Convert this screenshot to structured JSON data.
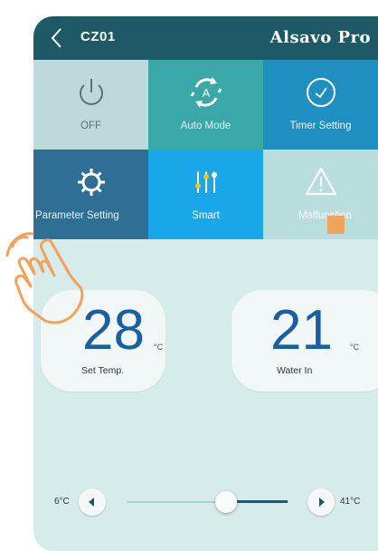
{
  "header": {
    "device_name": "CZ01",
    "app_title": "Alsavo Pro"
  },
  "tiles": [
    {
      "label": "OFF",
      "icon": "power-icon"
    },
    {
      "label": "Auto Mode",
      "icon": "auto-mode-icon"
    },
    {
      "label": "Timer Setting",
      "icon": "clock-icon"
    },
    {
      "label": "Parameter Setting",
      "icon": "gear-icon"
    },
    {
      "label": "Smart",
      "icon": "sliders-icon"
    },
    {
      "label": "Malfunction",
      "icon": "warning-icon"
    }
  ],
  "set_temp": {
    "value": "28",
    "unit": "°C",
    "label": "Set Temp."
  },
  "water_in": {
    "value": "21",
    "unit": "°C",
    "label": "Water In"
  },
  "slider": {
    "min_label": "6°C",
    "max_label": "41°C",
    "value_fraction": 0.62
  },
  "colors": {
    "header": "#1e5a66",
    "background": "#d6ecea",
    "accent": "#1aa7ea",
    "number": "#1a5fa3",
    "hand": "#f2a25c"
  }
}
